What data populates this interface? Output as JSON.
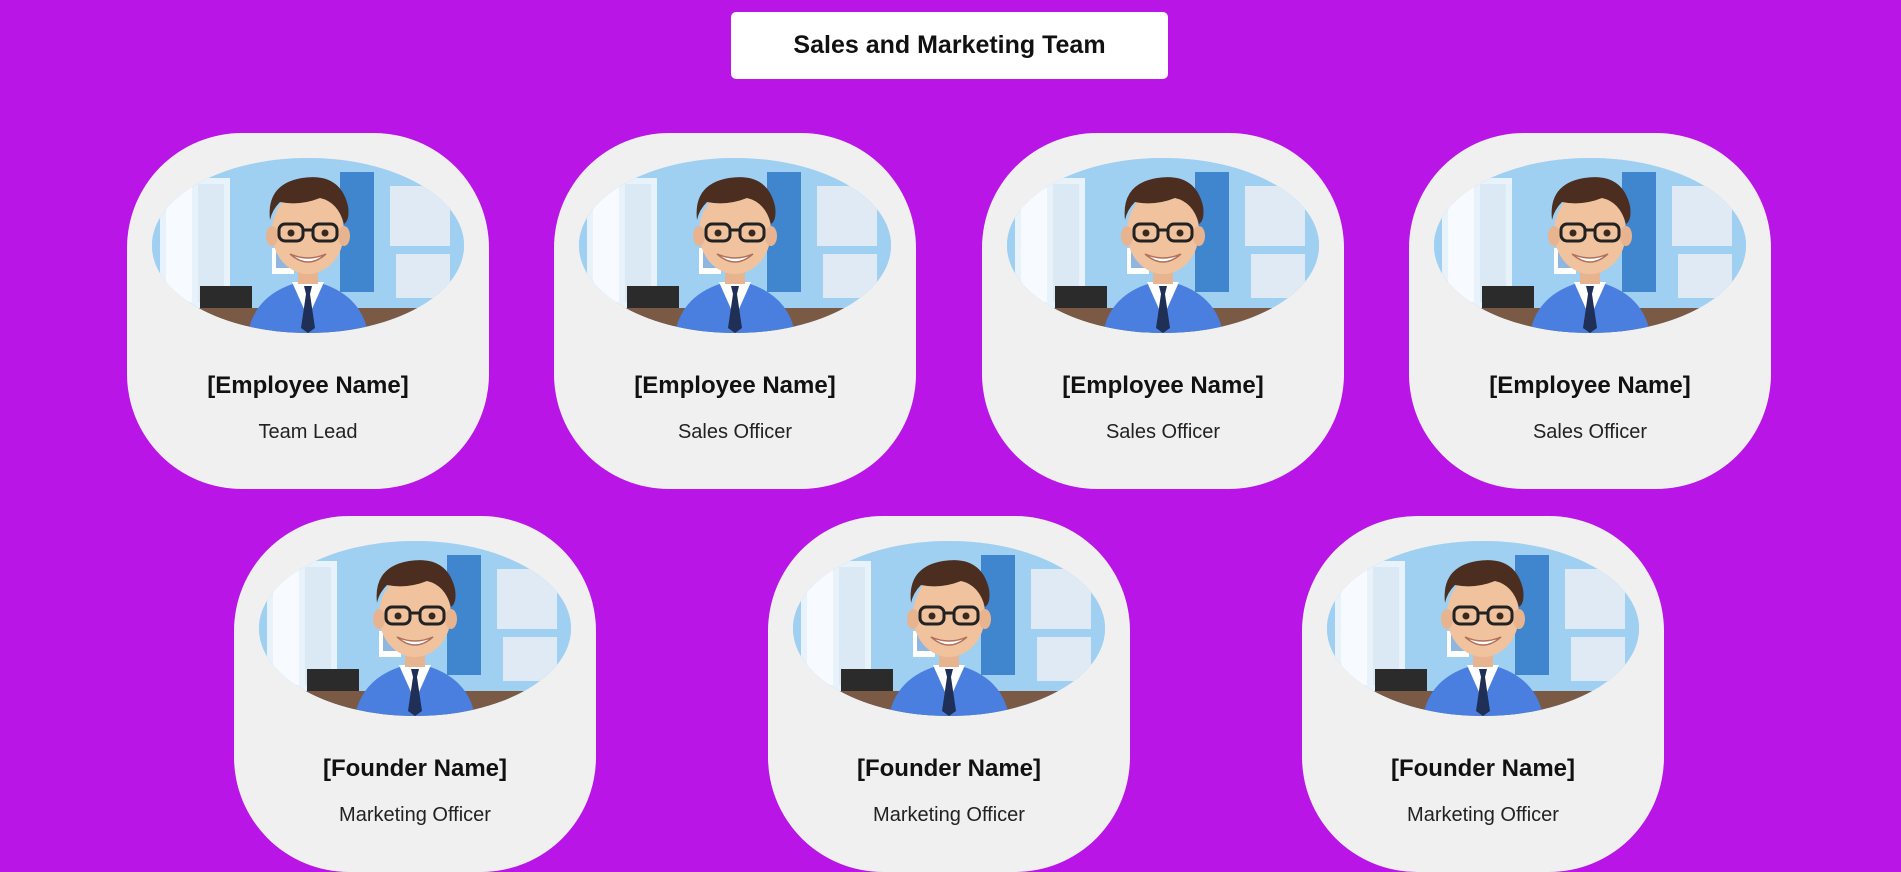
{
  "header": {
    "title": "Sales and Marketing Team"
  },
  "row1": [
    {
      "name": "[Employee Name]",
      "role": "Team Lead"
    },
    {
      "name": "[Employee Name]",
      "role": "Sales Officer"
    },
    {
      "name": "[Employee Name]",
      "role": "Sales Officer"
    },
    {
      "name": "[Employee Name]",
      "role": "Sales Officer"
    }
  ],
  "row2": [
    {
      "name": "[Founder Name]",
      "role": "Marketing Officer"
    },
    {
      "name": "[Founder Name]",
      "role": "Marketing Officer"
    },
    {
      "name": "[Founder Name]",
      "role": "Marketing Officer"
    }
  ],
  "colors": {
    "background": "#b915e6",
    "card": "#f0f0f0",
    "title_box": "#ffffff",
    "suit": "#4a7fe0"
  }
}
